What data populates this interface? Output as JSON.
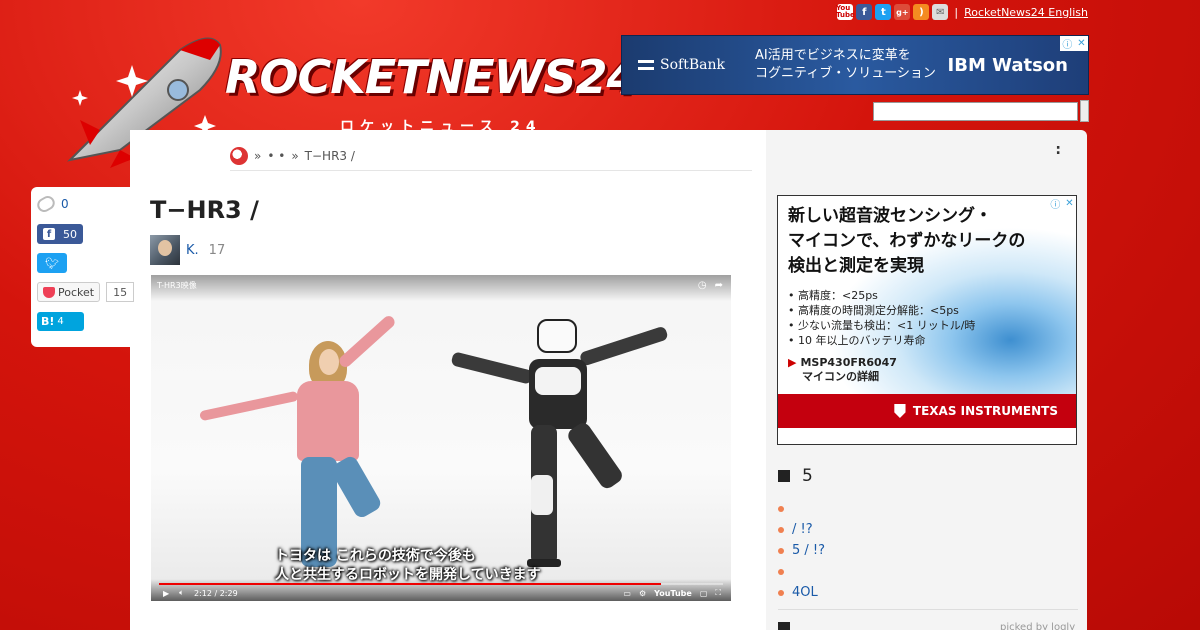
{
  "header": {
    "logo_text": "ROCKETNEWS24",
    "logo_sub": "ロケットニュース 24",
    "top_links": {
      "separator": "|",
      "english_link": "RocketNews24 English"
    },
    "icons": [
      "youtube-icon",
      "facebook-icon",
      "twitter-icon",
      "googleplus-icon",
      "rss-icon",
      "mail-icon"
    ]
  },
  "ads": {
    "top": {
      "brand": "SoftBank",
      "line1": "AI活用でビジネスに変革を",
      "line2": "コグニティブ・ソリューション",
      "partner": "IBM Watson"
    },
    "side": {
      "headline1": "新しい超音波センシング・",
      "headline2": "マイコンで、わずかなリークの",
      "headline3": "検出と測定を実現",
      "bullets": [
        "• 高精度：<25ps",
        "• 高精度の時間測定分解能：<5ps",
        "• 少ない流量も検出：<1 リットル/時",
        "• 10 年以上のバッテリ寿命"
      ],
      "product_line1": "MSP430FR6047",
      "product_line2": "マイコンの詳細",
      "brand": "TEXAS INSTRUMENTS"
    }
  },
  "breadcrumb": {
    "sep1": "»",
    "dots": "• •",
    "sep2": "»",
    "current": "T−HR3 /"
  },
  "sidebar_header": ":",
  "article": {
    "title": "T−HR3 /",
    "author_name": "K.",
    "author_count": "17"
  },
  "video": {
    "title": "T-HR3映像",
    "caption_line1": "トヨタは これらの技術で今後も",
    "caption_line2": "人と共生するロボットを開発していきます",
    "time": "2:12 / 2:29",
    "progress": 0.89,
    "youtube_label": "YouTube"
  },
  "social": {
    "clip_count": "0",
    "facebook_count": "50",
    "pocket_label": "Pocket",
    "pocket_count": "15",
    "hatena_label": "B!",
    "hatena_count": "4"
  },
  "ranking": {
    "heading_num": "5",
    "items": [
      "",
      "/ !?",
      "5 / !?",
      "",
      "4OL"
    ],
    "picked_by": "picked by logly"
  },
  "colors": {
    "header_red": "#d4140c",
    "link_blue": "#1a5aa8",
    "bullet_orange": "#f08050"
  }
}
